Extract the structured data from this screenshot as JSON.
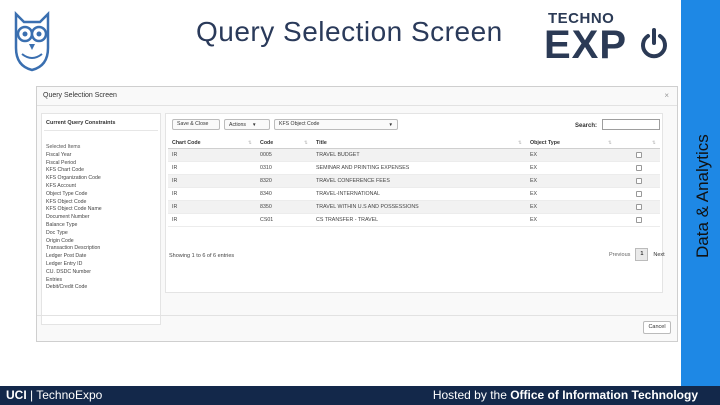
{
  "slide": {
    "title": "Query Selection Screen",
    "logo_top": "TECHNO",
    "logo_main": "EXP",
    "side_label": "Data & Analytics",
    "footer_left_bold": "UCI",
    "footer_left_rest": "| TechnoExpo",
    "footer_right_prefix": "Hosted by the ",
    "footer_right_bold": "Office of Information Technology",
    "colors": {
      "sidebar": "#1e88e5",
      "footer": "#13284a",
      "title": "#2a3a5a"
    }
  },
  "modal": {
    "title": "Query Selection Screen",
    "close": "×",
    "cancel_label": "Cancel"
  },
  "constraints": {
    "header": "Current Query Constraints",
    "items": [
      "Selected Items",
      "Fiscal Year",
      "Fiscal Period",
      "KFS Chart Code",
      "KFS Organization Code",
      "KFS Account",
      "Object Type Code",
      "KFS Object Code",
      "KFS Object Code Name",
      "Document Number",
      "Balance Type",
      "Doc Type",
      "Origin Code",
      "Transaction Description",
      "Ledger Post Date",
      "Ledger Entry ID",
      "CU. DSDC Number",
      "Entries",
      "Debit/Credit Code"
    ],
    "bottom": "—"
  },
  "toolbar": {
    "save_close": "Save & Close",
    "actions": "Actions",
    "field_select": "KFS Object Code",
    "search_label": "Search:",
    "search_value": ""
  },
  "table": {
    "headers": [
      "Chart Code",
      "Code",
      "Title",
      "Object Type"
    ],
    "rows": [
      [
        "IR",
        "0005",
        "TRAVEL BUDGET",
        "EX"
      ],
      [
        "IR",
        "0310",
        "SEMINAR AND PRINTING EXPENSES",
        "EX"
      ],
      [
        "IR",
        "8320",
        "TRAVEL CONFERENCE FEES",
        "EX"
      ],
      [
        "IR",
        "8340",
        "TRAVEL-INTERNATIONAL",
        "EX"
      ],
      [
        "IR",
        "8350",
        "TRAVEL WITHIN U.S AND POSSESSIONS",
        "EX"
      ],
      [
        "IR",
        "CS01",
        "CS TRANSFER - TRAVEL",
        "EX"
      ]
    ],
    "info": "Showing 1 to 6 of 6 entries",
    "prev": "Previous",
    "page": "1",
    "next": "Next"
  }
}
